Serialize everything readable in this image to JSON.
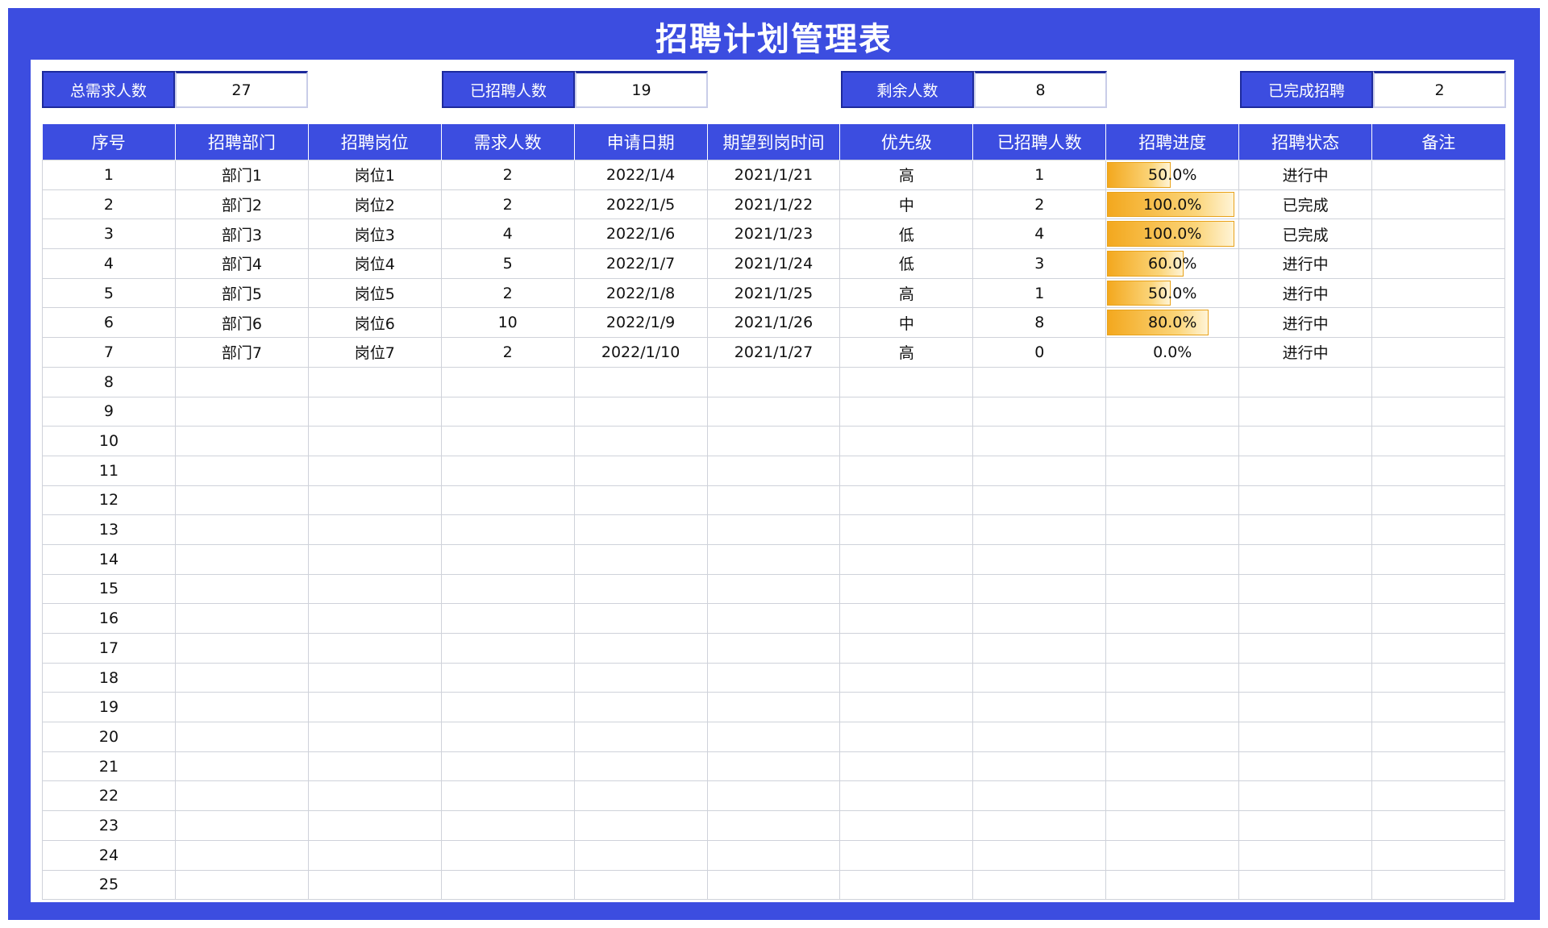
{
  "title": "招聘计划管理表",
  "colors": {
    "accent": "#3c4de0",
    "progress": "#f3a81e"
  },
  "stats": [
    {
      "label": "总需求人数",
      "value": "27"
    },
    {
      "label": "已招聘人数",
      "value": "19"
    },
    {
      "label": "剩余人数",
      "value": "8"
    },
    {
      "label": "已完成招聘",
      "value": "2"
    }
  ],
  "table": {
    "headers": [
      "序号",
      "招聘部门",
      "招聘岗位",
      "需求人数",
      "申请日期",
      "期望到岗时间",
      "优先级",
      "已招聘人数",
      "招聘进度",
      "招聘状态",
      "备注"
    ],
    "rows": [
      {
        "no": "1",
        "dept": "部门1",
        "post": "岗位1",
        "need": "2",
        "apply": "2022/1/4",
        "expect": "2021/1/21",
        "priority": "高",
        "hired": "1",
        "progress": "50.0%",
        "progress_value": 0.5,
        "status": "进行中",
        "note": ""
      },
      {
        "no": "2",
        "dept": "部门2",
        "post": "岗位2",
        "need": "2",
        "apply": "2022/1/5",
        "expect": "2021/1/22",
        "priority": "中",
        "hired": "2",
        "progress": "100.0%",
        "progress_value": 1.0,
        "status": "已完成",
        "note": ""
      },
      {
        "no": "3",
        "dept": "部门3",
        "post": "岗位3",
        "need": "4",
        "apply": "2022/1/6",
        "expect": "2021/1/23",
        "priority": "低",
        "hired": "4",
        "progress": "100.0%",
        "progress_value": 1.0,
        "status": "已完成",
        "note": ""
      },
      {
        "no": "4",
        "dept": "部门4",
        "post": "岗位4",
        "need": "5",
        "apply": "2022/1/7",
        "expect": "2021/1/24",
        "priority": "低",
        "hired": "3",
        "progress": "60.0%",
        "progress_value": 0.6,
        "status": "进行中",
        "note": ""
      },
      {
        "no": "5",
        "dept": "部门5",
        "post": "岗位5",
        "need": "2",
        "apply": "2022/1/8",
        "expect": "2021/1/25",
        "priority": "高",
        "hired": "1",
        "progress": "50.0%",
        "progress_value": 0.5,
        "status": "进行中",
        "note": ""
      },
      {
        "no": "6",
        "dept": "部门6",
        "post": "岗位6",
        "need": "10",
        "apply": "2022/1/9",
        "expect": "2021/1/26",
        "priority": "中",
        "hired": "8",
        "progress": "80.0%",
        "progress_value": 0.8,
        "status": "进行中",
        "note": ""
      },
      {
        "no": "7",
        "dept": "部门7",
        "post": "岗位7",
        "need": "2",
        "apply": "2022/1/10",
        "expect": "2021/1/27",
        "priority": "高",
        "hired": "0",
        "progress": "0.0%",
        "progress_value": 0.0,
        "status": "进行中",
        "note": ""
      },
      {
        "no": "8"
      },
      {
        "no": "9"
      },
      {
        "no": "10"
      },
      {
        "no": "11"
      },
      {
        "no": "12"
      },
      {
        "no": "13"
      },
      {
        "no": "14"
      },
      {
        "no": "15"
      },
      {
        "no": "16"
      },
      {
        "no": "17"
      },
      {
        "no": "18"
      },
      {
        "no": "19"
      },
      {
        "no": "20"
      },
      {
        "no": "21"
      },
      {
        "no": "22"
      },
      {
        "no": "23"
      },
      {
        "no": "24"
      },
      {
        "no": "25"
      }
    ]
  }
}
